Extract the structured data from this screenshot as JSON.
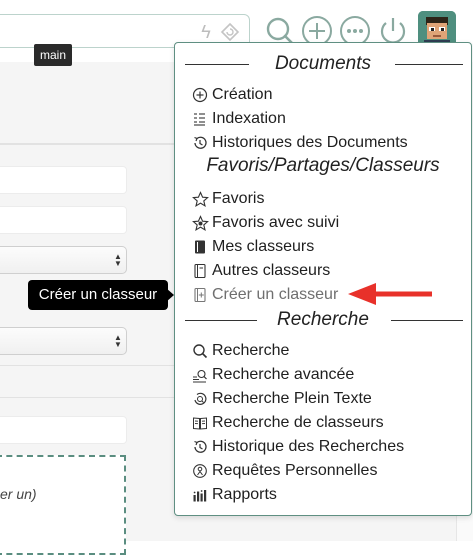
{
  "toolbar": {
    "main_tooltip": "main"
  },
  "background": {
    "dashed_text": "er un)"
  },
  "menu": {
    "sections": {
      "documents": "Documents",
      "favoris": "Favoris/Partages/Classeurs",
      "recherche": "Recherche"
    },
    "items": {
      "creation": "Création",
      "indexation": "Indexation",
      "historiques_documents": "Historiques des Documents",
      "favoris": "Favoris",
      "favoris_suivi": "Favoris avec suivi",
      "mes_classeurs": "Mes classeurs",
      "autres_classeurs": "Autres classeurs",
      "creer_classeur": "Créer un classeur",
      "recherche": "Recherche",
      "recherche_avancee": "Recherche avancée",
      "recherche_plein_texte": "Recherche Plein Texte",
      "recherche_classeurs": "Recherche de classeurs",
      "historique_recherches": "Historique des Recherches",
      "requetes_personnelles": "Requêtes Personnelles",
      "rapports": "Rapports"
    }
  },
  "tooltip": {
    "create_classeur": "Créer un classeur"
  },
  "colors": {
    "accent": "#5f8f82",
    "annotation_arrow": "#e8312a"
  }
}
